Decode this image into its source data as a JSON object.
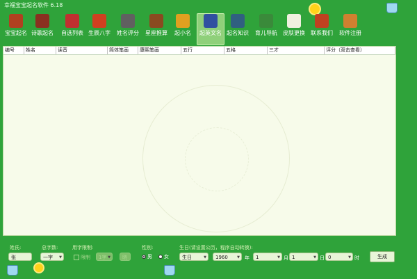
{
  "window": {
    "title": "幸福宝宝起名软件 6.18"
  },
  "toolbar": {
    "items": [
      {
        "label": "宝宝起名",
        "icon": "book-icon",
        "color": "#b04020"
      },
      {
        "label": "诗歌起名",
        "icon": "poetry-book-icon",
        "color": "#8a3020"
      },
      {
        "label": "自选列表",
        "icon": "list-icon",
        "color": "#c03030"
      },
      {
        "label": "生辰八字",
        "icon": "calendar-icon",
        "color": "#d04020"
      },
      {
        "label": "姓名评分",
        "icon": "rating-icon",
        "color": "#606060"
      },
      {
        "label": "星座推算",
        "icon": "star-icon",
        "color": "#8a4a20"
      },
      {
        "label": "起小名",
        "icon": "face-icon",
        "color": "#e0a020"
      },
      {
        "label": "起英文名",
        "icon": "us-flag-icon",
        "color": "#3050a0"
      },
      {
        "label": "起名知识",
        "icon": "books-icon",
        "color": "#306080"
      },
      {
        "label": "育儿导航",
        "icon": "footprint-icon",
        "color": "#3a8a3a"
      },
      {
        "label": "皮肤更换",
        "icon": "palette-icon",
        "color": "#f0f0e0"
      },
      {
        "label": "联系我们",
        "icon": "house-icon",
        "color": "#c04020"
      },
      {
        "label": "软件注册",
        "icon": "people-icon",
        "color": "#d08030"
      }
    ]
  },
  "table": {
    "columns": [
      "编号",
      "姓名",
      "读音",
      "简体笔画",
      "康熙笔画",
      "五行",
      "五格",
      "三才",
      "评分（双击查看）"
    ]
  },
  "form": {
    "surname_label": "姓氏:",
    "surname_value": "张",
    "total_chars_label": "总字数:",
    "total_chars_value": "一字",
    "char_limit_label": "用字限制:",
    "char_limit_checkbox": "限制",
    "char_limit_position": "1字",
    "char_limit_value": "晓",
    "gender_label": "性别:",
    "gender_male": "男",
    "gender_female": "女",
    "gender_selected": "男",
    "birthday_label": "生日(请设置公历，程序自动转换):",
    "calendar_type": "生日",
    "year": "1960",
    "year_unit": "年",
    "month": "1",
    "month_unit": "月",
    "day": "1",
    "day_unit": "日",
    "hour": "0",
    "hour_unit": "时",
    "generate_button": "生成"
  }
}
